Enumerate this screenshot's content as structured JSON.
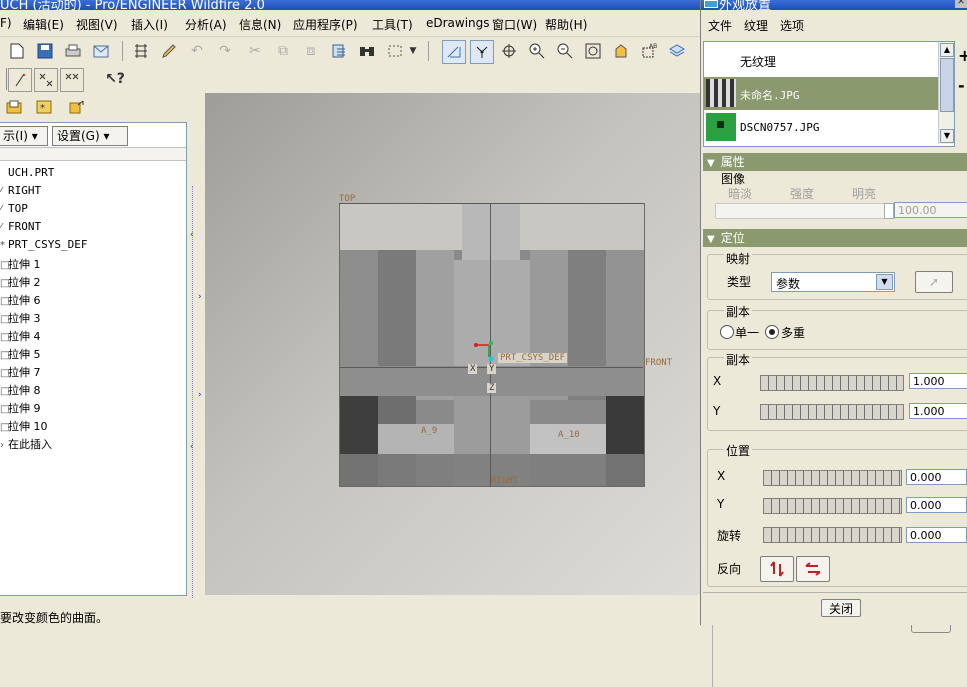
{
  "window": {
    "title": "UCH (活动的) - Pro/ENGINEER Wildfire 2.0"
  },
  "menubar": {
    "items": [
      "F)",
      "编辑(E)",
      "视图(V)",
      "插入(I)",
      "分析(A)",
      "信息(N)",
      "应用程序(P)",
      "工具(T)",
      "eDrawings",
      "窗口(W)",
      "帮助(H)"
    ]
  },
  "left_panel": {
    "show_dropdown": "示(I)",
    "settings_dropdown": "设置(G)",
    "tree": [
      {
        "label": "UCH.PRT",
        "icon": "part-icon"
      },
      {
        "label": "RIGHT",
        "icon": "datum-plane-icon"
      },
      {
        "label": "TOP",
        "icon": "datum-plane-icon"
      },
      {
        "label": "FRONT",
        "icon": "datum-plane-icon"
      },
      {
        "label": "PRT_CSYS_DEF",
        "icon": "csys-icon"
      },
      {
        "label": "拉伸 1",
        "icon": "extrude-icon"
      },
      {
        "label": "拉伸 2",
        "icon": "extrude-icon"
      },
      {
        "label": "拉伸 6",
        "icon": "extrude-icon"
      },
      {
        "label": "拉伸 3",
        "icon": "extrude-icon"
      },
      {
        "label": "拉伸 4",
        "icon": "extrude-icon"
      },
      {
        "label": "拉伸 5",
        "icon": "extrude-icon"
      },
      {
        "label": "拉伸 7",
        "icon": "extrude-icon"
      },
      {
        "label": "拉伸 8",
        "icon": "extrude-icon"
      },
      {
        "label": "拉伸 9",
        "icon": "extrude-icon"
      },
      {
        "label": "拉伸 10",
        "icon": "extrude-icon"
      },
      {
        "label": "在此插入",
        "icon": "insert-arrow-icon"
      }
    ]
  },
  "graphics": {
    "labels": {
      "top": "TOP",
      "front": "FRONT",
      "right": "RIGHT",
      "csys": "PRT_CSYS_DEF",
      "a9": "A_9",
      "a10": "A_10",
      "x": "X",
      "y": "Y",
      "z": "Z"
    }
  },
  "status": {
    "message": "要改变颜色的曲面。"
  },
  "dialog": {
    "title": "外观放置",
    "menu": [
      "文件",
      "纹理",
      "选项"
    ],
    "texture_list": [
      {
        "label": "无纹理",
        "selected": false
      },
      {
        "label": "未命名.JPG",
        "selected": true
      },
      {
        "label": "DSCN0757.JPG",
        "selected": false
      }
    ],
    "properties": {
      "header": "属性",
      "image_label": "图像",
      "dark": "暗淡",
      "intensity": "强度",
      "bright": "明亮",
      "value": "100.00"
    },
    "placement": {
      "header": "定位",
      "mapping_label": "映射",
      "type_label": "类型",
      "type_value": "参数",
      "copies_label": "副本",
      "single": "单一",
      "multiple": "多重",
      "selected_option": "多重",
      "scale_label": "副本",
      "scale_x_label": "X",
      "scale_y_label": "Y",
      "scale_x": "1.000",
      "scale_y": "1.000",
      "position_label": "位置",
      "pos_x_label": "X",
      "pos_y_label": "Y",
      "rotate_label": "旋转",
      "pos_x": "0.000",
      "pos_y": "0.000",
      "rotate": "0.000",
      "flip_label": "反向"
    },
    "close_button": "关闭"
  }
}
